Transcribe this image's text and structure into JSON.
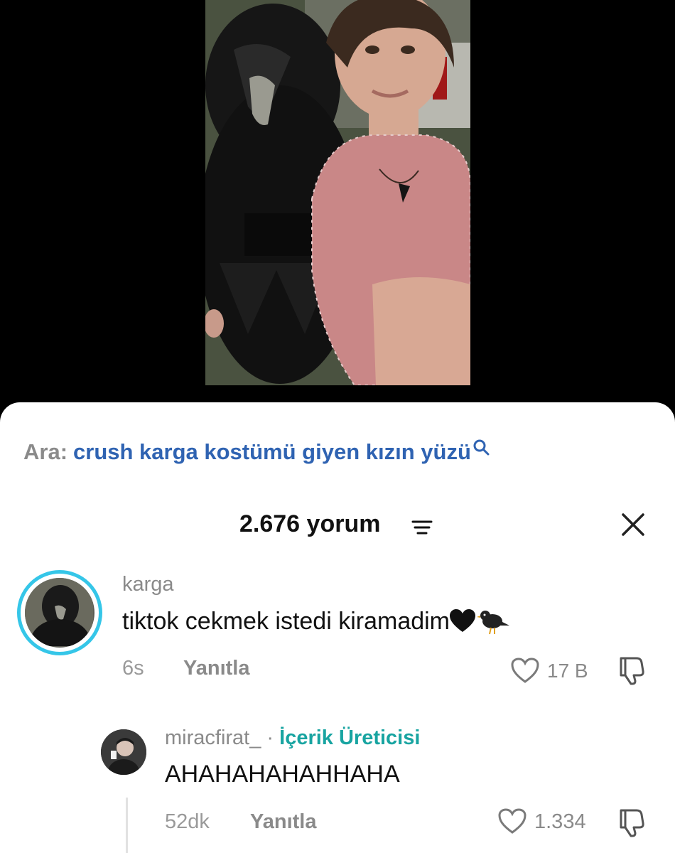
{
  "search": {
    "label": "Ara:",
    "query": "crush karga kostümü giyen kızın yüzü"
  },
  "comments_header": {
    "count_text": "2.676 yorum"
  },
  "comment": {
    "username": "karga",
    "text": "tiktok cekmek istedi kiramadim",
    "emojis": [
      "black-heart",
      "black-bird"
    ],
    "time": "6s",
    "reply_label": "Yanıtla",
    "like_count": "17 B"
  },
  "reply": {
    "username": "miracfirat_",
    "separator": " · ",
    "badge": "İçerik Üreticisi",
    "text": "AHAHAHAHAHHAHA",
    "time": "52dk",
    "reply_label": "Yanıtla",
    "like_count": "1.334"
  },
  "colors": {
    "search_query": "#2f63b2",
    "creator_badge": "#18a4a1",
    "avatar_ring": "#35c6e8",
    "muted_text": "#8a8a8a"
  }
}
